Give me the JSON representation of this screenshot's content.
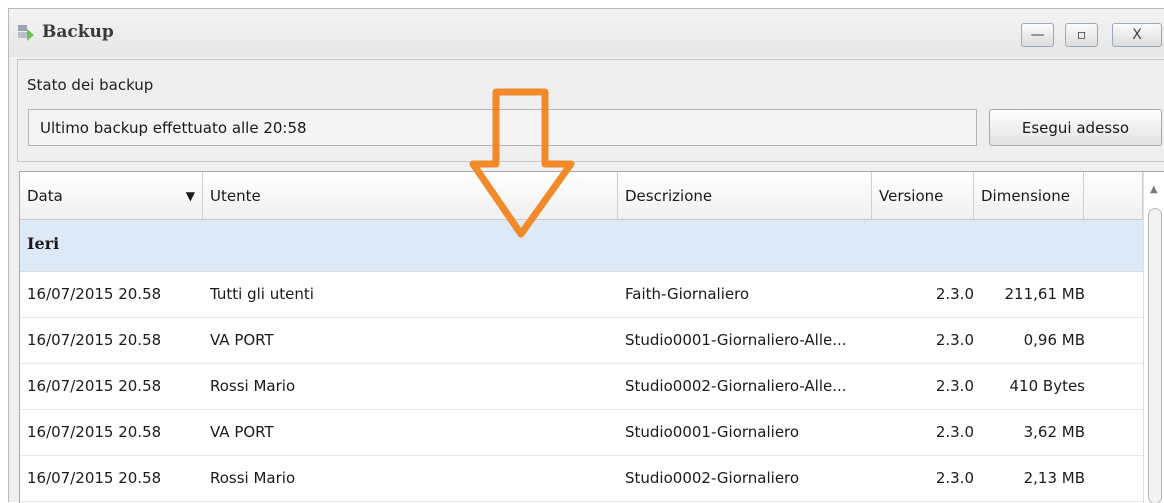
{
  "window": {
    "title": "Backup",
    "icon": "backup-app-icon"
  },
  "window_controls": {
    "minimize": "—",
    "maximize": "▫",
    "close": "X"
  },
  "status_panel": {
    "label": "Stato dei backup",
    "status_text": "Ultimo backup effettuato alle 20:58",
    "run_button_label": "Esegui adesso"
  },
  "table": {
    "columns": [
      "Data",
      "Utente",
      "Descrizione",
      "Versione",
      "Dimensione"
    ],
    "sort_column": "Data",
    "group_label": "Ieri",
    "rows": [
      {
        "date": "16/07/2015 20.58",
        "user": "Tutti gli utenti",
        "description": "Faith-Giornaliero",
        "version": "2.3.0",
        "size": "211,61 MB"
      },
      {
        "date": "16/07/2015 20.58",
        "user": "VA PORT",
        "description": "Studio0001-Giornaliero-Alle...",
        "version": "2.3.0",
        "size": "0,96 MB"
      },
      {
        "date": "16/07/2015 20.58",
        "user": "Rossi Mario",
        "description": "Studio0002-Giornaliero-Alle...",
        "version": "2.3.0",
        "size": "410 Bytes"
      },
      {
        "date": "16/07/2015 20.58",
        "user": "VA PORT",
        "description": "Studio0001-Giornaliero",
        "version": "2.3.0",
        "size": "3,62 MB"
      },
      {
        "date": "16/07/2015 20.58",
        "user": "Rossi Mario",
        "description": "Studio0002-Giornaliero",
        "version": "2.3.0",
        "size": "2,13 MB"
      }
    ]
  },
  "colors": {
    "group_row_bg": "#dde9f6",
    "annotation_arrow": "#f28a2a"
  }
}
